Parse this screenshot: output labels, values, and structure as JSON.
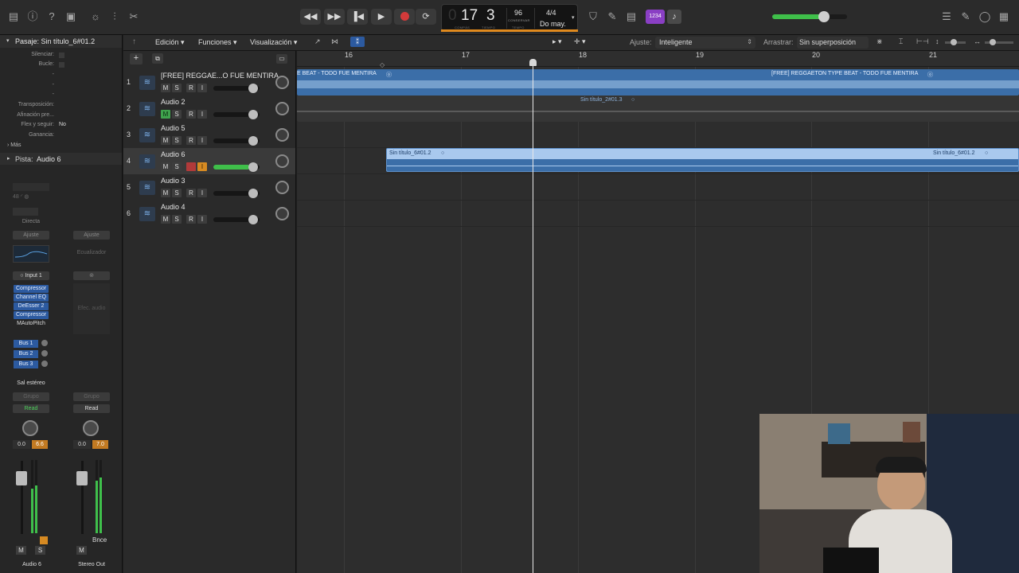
{
  "transport": {
    "bar": "17",
    "beat": "3",
    "bar_caption": "COMPÁS",
    "beat_caption": "TIEMPO",
    "tempo": "96",
    "tempo_mode": "CONSERVAR",
    "tempo_caption": "TEMPO",
    "signature": "4/4",
    "key": "Do may.",
    "count_in_badge": "1234"
  },
  "toolbar": {
    "edit_menu": "Edición",
    "functions_menu": "Funciones",
    "view_menu": "Visualización",
    "snap_label": "Ajuste:",
    "snap_value": "Inteligente",
    "drag_label": "Arrastrar:",
    "drag_value": "Sin superposición"
  },
  "inspector": {
    "region_header": "Pasaje: Sin título_6#01.2",
    "rows": [
      {
        "label": "Silenciar:",
        "value": ""
      },
      {
        "label": "Bucle:",
        "value": ""
      },
      {
        "label": "-",
        "value": ""
      },
      {
        "label": "-",
        "value": ""
      },
      {
        "label": "-",
        "value": ""
      },
      {
        "label": "Transposición:",
        "value": ""
      },
      {
        "label": "Afinación pre...",
        "value": ""
      },
      {
        "label": "Flex y seguir:",
        "value": "No"
      },
      {
        "label": "Ganancia:",
        "value": ""
      }
    ],
    "more": "Más",
    "track_header_label": "Pista:",
    "track_header_value": "Audio 6"
  },
  "channel_strip": {
    "directa": "Directa",
    "setting_left": "Ajuste",
    "setting_right": "Ajuste",
    "eq_label": "Ecualizador",
    "input": "Input 1",
    "plugins": [
      "Compressor",
      "Channel EQ",
      "DeEsser 2",
      "Compressor",
      "MAutoPitch"
    ],
    "audio_fx_placeholder": "Efec. audio",
    "sends": [
      "Bus 1",
      "Bus 2",
      "Bus 3"
    ],
    "output": "Sal estéreo",
    "group_left": "Grupo",
    "group_right": "Grupo",
    "automation_left": "Read",
    "automation_right": "Read",
    "vol_left": "0.0",
    "peak_left": "6.6",
    "vol_right": "0.0",
    "peak_right": "7.0",
    "bnce": "Bnce",
    "mute_left": "M",
    "solo_left": "S",
    "mute_right": "M",
    "name_left": "Audio 6",
    "name_right": "Stereo Out"
  },
  "track_buttons": {
    "mute": "M",
    "solo": "S",
    "record": "R",
    "input": "I"
  },
  "tracks": [
    {
      "num": "1",
      "name": "[FREE] REGGAE...O FUE MENTIRA"
    },
    {
      "num": "2",
      "name": "Audio 2"
    },
    {
      "num": "3",
      "name": "Audio 5"
    },
    {
      "num": "4",
      "name": "Audio 6"
    },
    {
      "num": "5",
      "name": "Audio 3"
    },
    {
      "num": "6",
      "name": "Audio 4"
    }
  ],
  "ruler": [
    "16",
    "17",
    "18",
    "19",
    "20",
    "21"
  ],
  "regions": {
    "track1_left": "E BEAT - TODO FUE MENTIRA",
    "track1_right": "[FREE] REGGAETON TYPE BEAT - TODO FUE MENTIRA",
    "track2": "Sin título_2#01.3",
    "track4_left": "Sin título_6#01.2",
    "track4_right": "Sin título_6#01.2"
  },
  "colors": {
    "region_blue": "#3b6ea8",
    "region_selected": "#a9c9ee",
    "record_red": "#d23a3a",
    "lcd_accent": "#e08a1e",
    "plugin_blue": "#2c5aa0",
    "automation_green": "#3fa34d"
  }
}
